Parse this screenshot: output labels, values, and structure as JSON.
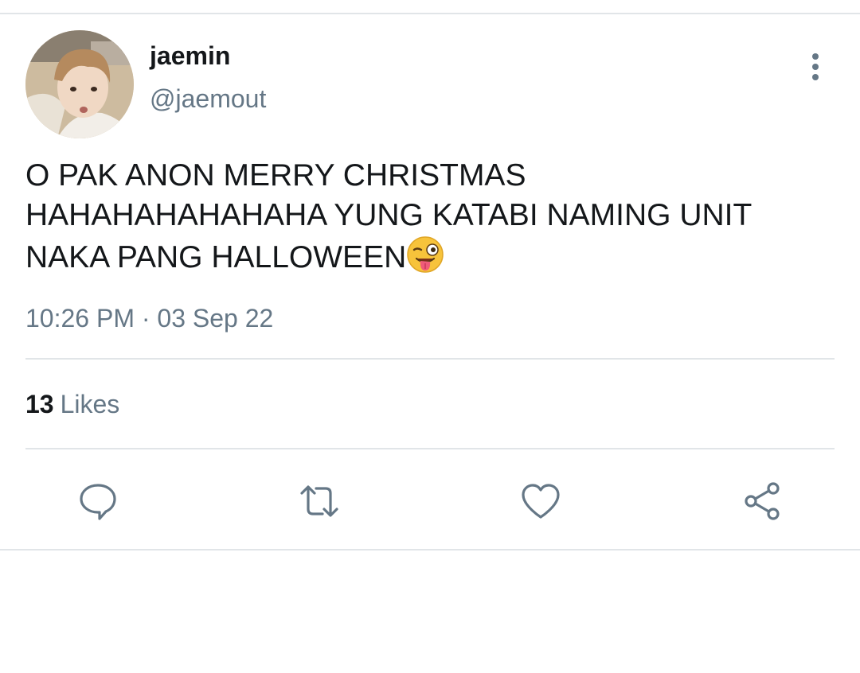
{
  "user": {
    "display_name": "jaemin",
    "handle": "@jaemout"
  },
  "tweet": {
    "text": "O PAK ANON MERRY CHRISTMAS\nHAHAHAHAHAHAHA YUNG KATABI NAMING UNIT\nNAKA PANG HALLOWEEN",
    "emoji": "winking-face-with-tongue",
    "timestamp": "10:26 PM · 03 Sep 22"
  },
  "stats": {
    "likes_count": "13",
    "likes_label": "Likes"
  },
  "actions": {
    "icons": [
      "reply-icon",
      "retweet-icon",
      "like-icon",
      "share-icon"
    ]
  },
  "colors": {
    "primary_text": "#14171a",
    "secondary_text": "#657786",
    "divider": "#e1e5e8",
    "icon": "#657786"
  }
}
